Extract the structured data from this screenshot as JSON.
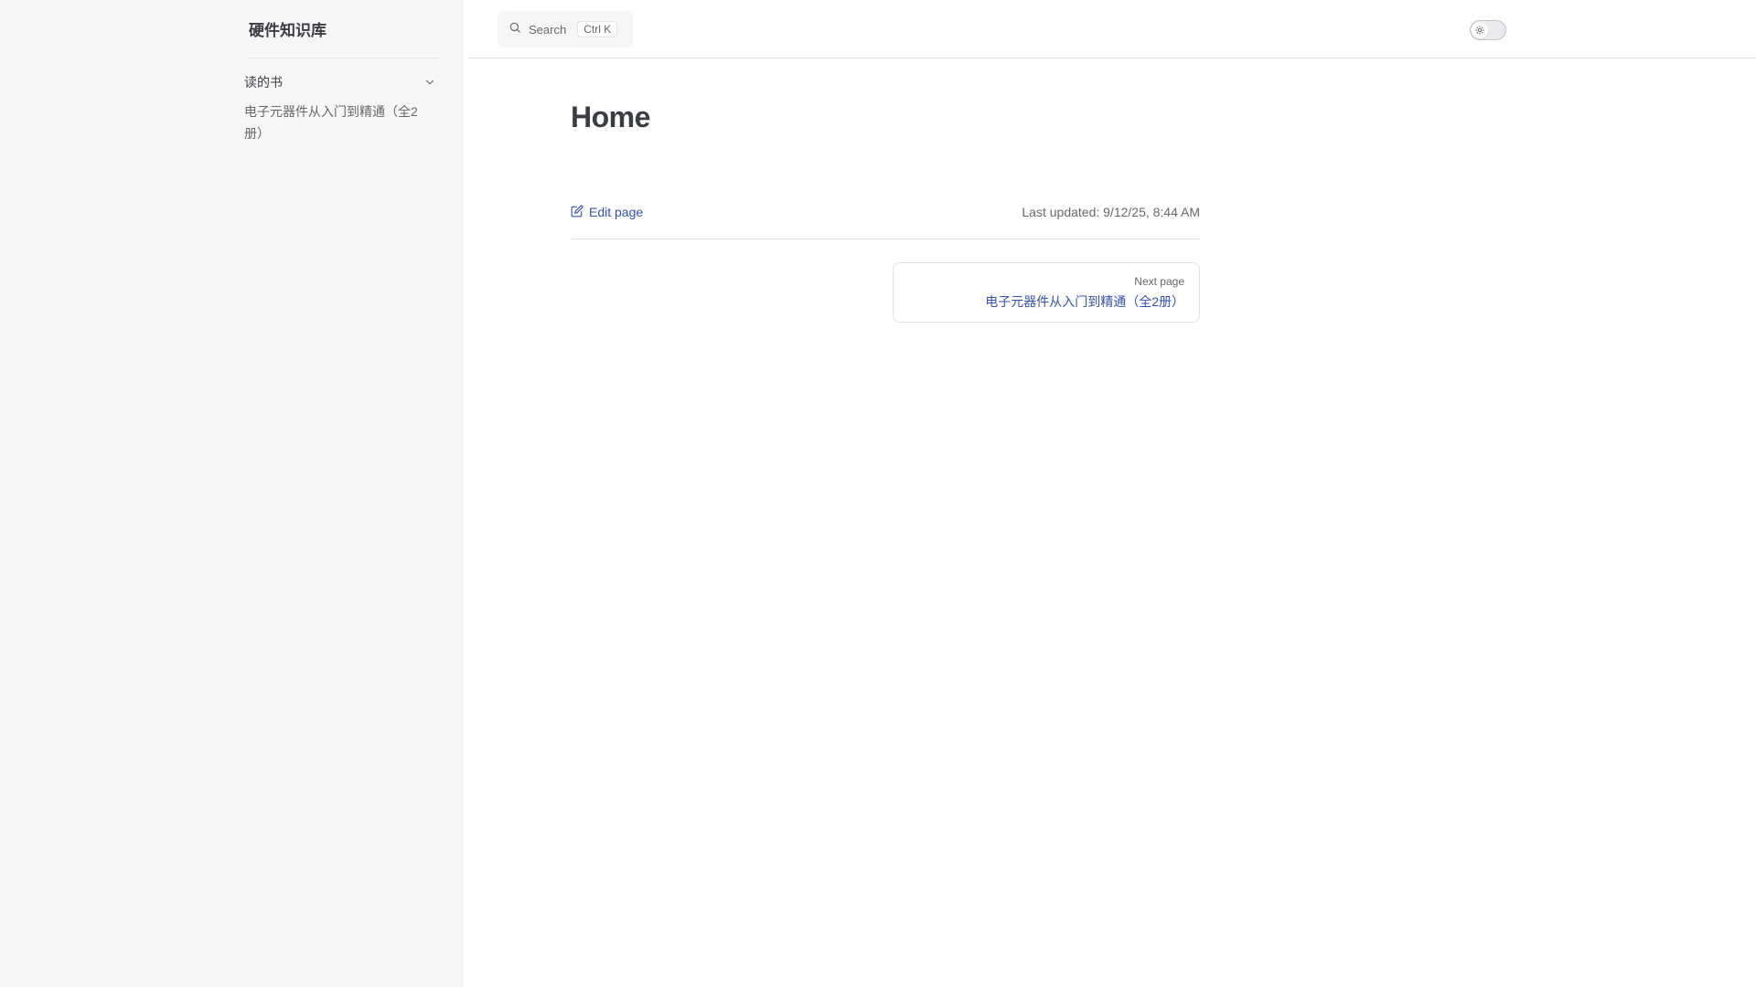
{
  "site": {
    "title": "硬件知识库"
  },
  "sidebar": {
    "group": {
      "title": "读的书",
      "items": [
        {
          "label": "电子元器件从入门到精通（全2册）"
        }
      ]
    }
  },
  "topbar": {
    "search": {
      "label": "Search",
      "shortcut": "Ctrl K"
    },
    "theme_toggle": {
      "icon": "sun-icon"
    }
  },
  "page": {
    "title": "Home",
    "edit_label": "Edit page",
    "last_updated_label": "Last updated:",
    "last_updated_value": "9/12/25, 8:44 AM",
    "next": {
      "desc": "Next page",
      "title": "电子元器件从入门到精通（全2册）"
    }
  },
  "colors": {
    "brand": "#3451b2",
    "sidebar_bg": "#f6f6f7",
    "divider": "#e2e2e3",
    "text": "#3c3c43",
    "muted": "#67676c"
  }
}
